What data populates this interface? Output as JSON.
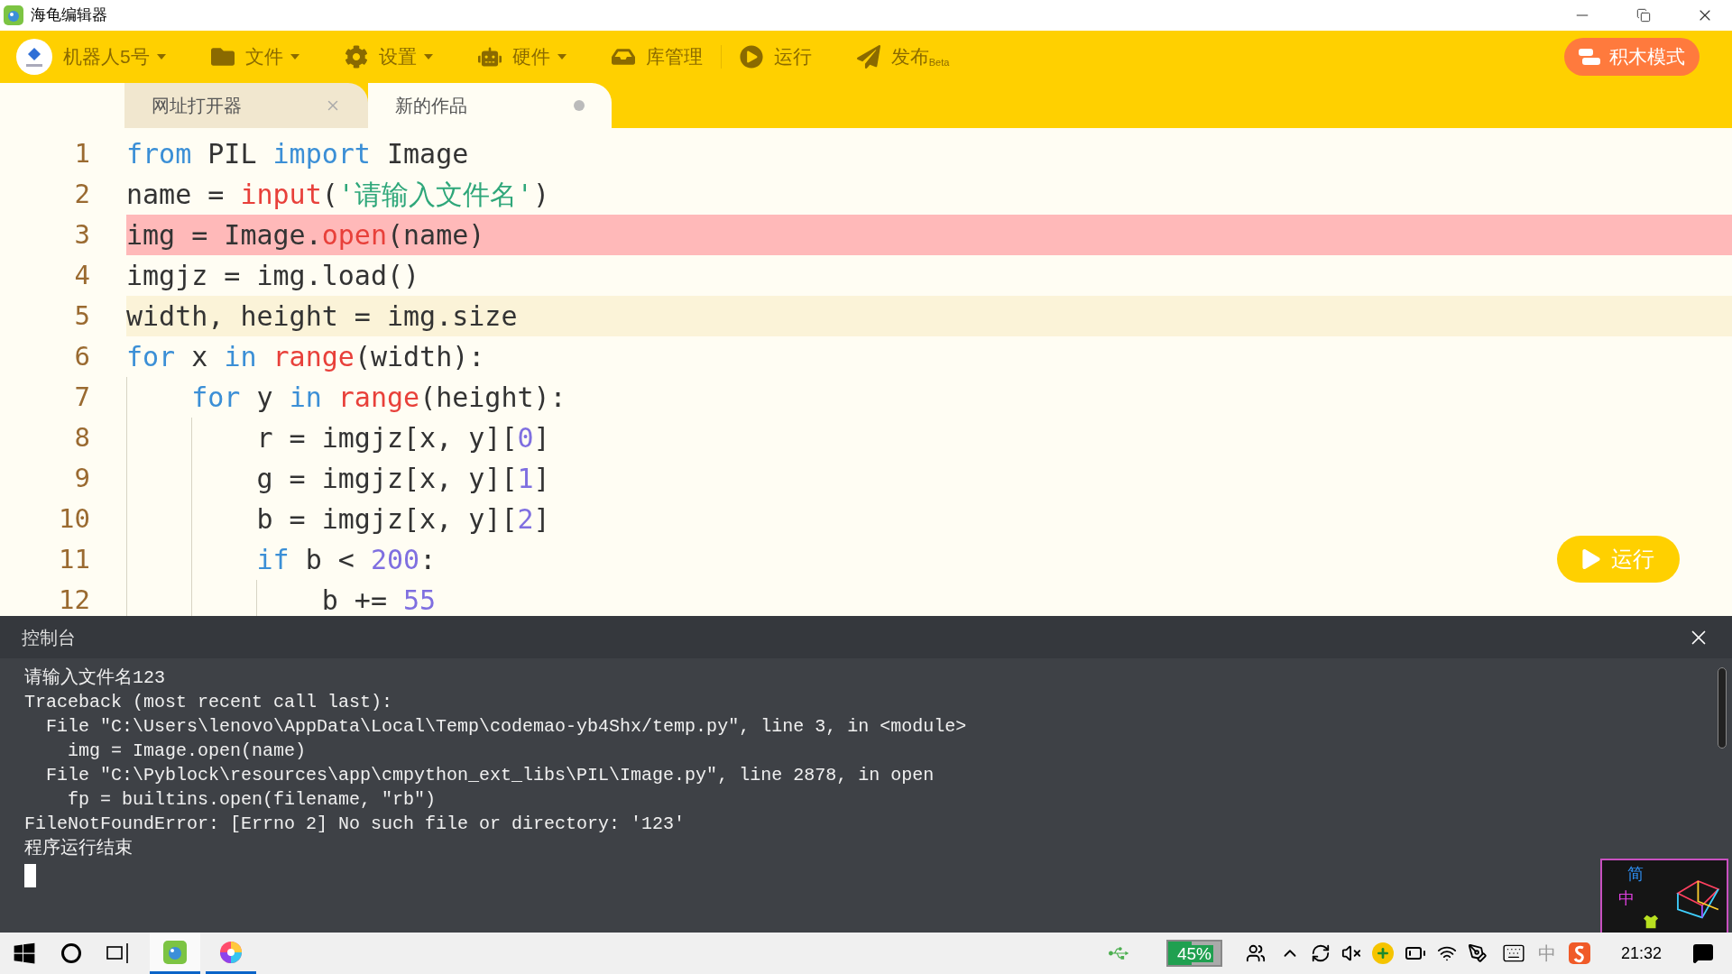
{
  "window": {
    "title": "海龟编辑器"
  },
  "toolbar": {
    "robot": {
      "label": "机器人5号"
    },
    "menus": [
      {
        "label": "文件",
        "kind": "dropdown"
      },
      {
        "label": "设置",
        "kind": "dropdown"
      },
      {
        "label": "硬件",
        "kind": "dropdown"
      },
      {
        "label": "库管理",
        "kind": "action"
      },
      {
        "label": "运行",
        "kind": "action"
      },
      {
        "label": "发布",
        "badge": "Beta",
        "kind": "action"
      }
    ],
    "mode_button": "积木模式"
  },
  "tabs": [
    {
      "label": "网址打开器",
      "selected": false,
      "modified": false
    },
    {
      "label": "新的作品",
      "selected": true,
      "modified": true
    }
  ],
  "editor": {
    "lines": [
      {
        "number": "1",
        "error": false,
        "current": false,
        "tokens": [
          {
            "text": "from",
            "kind": "keyword"
          },
          {
            "text": " PIL ",
            "kind": "plain"
          },
          {
            "text": "import",
            "kind": "keyword"
          },
          {
            "text": " Image",
            "kind": "plain"
          }
        ]
      },
      {
        "number": "2",
        "error": false,
        "current": false,
        "tokens": [
          {
            "text": "name = ",
            "kind": "plain"
          },
          {
            "text": "input",
            "kind": "func"
          },
          {
            "text": "(",
            "kind": "plain"
          },
          {
            "text": "'请输入文件名'",
            "kind": "string"
          },
          {
            "text": ")",
            "kind": "plain"
          }
        ]
      },
      {
        "number": "3",
        "error": true,
        "current": false,
        "tokens": [
          {
            "text": "img = Image.",
            "kind": "plain"
          },
          {
            "text": "open",
            "kind": "func"
          },
          {
            "text": "(name)",
            "kind": "plain"
          }
        ]
      },
      {
        "number": "4",
        "error": false,
        "current": false,
        "tokens": [
          {
            "text": "imgjz = img.load()",
            "kind": "plain"
          }
        ]
      },
      {
        "number": "5",
        "error": false,
        "current": true,
        "tokens": [
          {
            "text": "width, height = img.size",
            "kind": "plain"
          }
        ]
      },
      {
        "number": "6",
        "error": false,
        "current": false,
        "tokens": [
          {
            "text": "for",
            "kind": "keyword"
          },
          {
            "text": " x ",
            "kind": "plain"
          },
          {
            "text": "in ",
            "kind": "keyword"
          },
          {
            "text": "range",
            "kind": "func"
          },
          {
            "text": "(width):",
            "kind": "plain"
          }
        ]
      },
      {
        "number": "7",
        "error": false,
        "current": false,
        "tokens": [
          {
            "text": "    for",
            "kind": "keyword"
          },
          {
            "text": " y ",
            "kind": "plain"
          },
          {
            "text": "in ",
            "kind": "keyword"
          },
          {
            "text": "range",
            "kind": "func"
          },
          {
            "text": "(height):",
            "kind": "plain"
          }
        ]
      },
      {
        "number": "8",
        "error": false,
        "current": false,
        "tokens": [
          {
            "text": "        r = imgjz[x, y][",
            "kind": "plain"
          },
          {
            "text": "0",
            "kind": "number"
          },
          {
            "text": "]",
            "kind": "plain"
          }
        ]
      },
      {
        "number": "9",
        "error": false,
        "current": false,
        "tokens": [
          {
            "text": "        g = imgjz[x, y][",
            "kind": "plain"
          },
          {
            "text": "1",
            "kind": "number"
          },
          {
            "text": "]",
            "kind": "plain"
          }
        ]
      },
      {
        "number": "10",
        "error": false,
        "current": false,
        "tokens": [
          {
            "text": "        b = imgjz[x, y][",
            "kind": "plain"
          },
          {
            "text": "2",
            "kind": "number"
          },
          {
            "text": "]",
            "kind": "plain"
          }
        ]
      },
      {
        "number": "11",
        "error": false,
        "current": false,
        "tokens": [
          {
            "text": "        if",
            "kind": "keyword"
          },
          {
            "text": " b < ",
            "kind": "plain"
          },
          {
            "text": "200",
            "kind": "number"
          },
          {
            "text": ":",
            "kind": "plain"
          }
        ]
      },
      {
        "number": "12",
        "error": false,
        "current": false,
        "tokens": [
          {
            "text": "            b += ",
            "kind": "plain"
          },
          {
            "text": "55",
            "kind": "number"
          }
        ]
      }
    ],
    "run_button": "运行"
  },
  "console": {
    "title": "控制台",
    "lines": [
      "请输入文件名123",
      "Traceback (most recent call last):",
      "  File \"C:\\Users\\lenovo\\AppData\\Local\\Temp\\codemao-yb4Shx/temp.py\", line 3, in <module>",
      "    img = Image.open(name)",
      "  File \"C:\\Pyblock\\resources\\app\\cmpython_ext_libs\\PIL\\Image.py\", line 2878, in open",
      "    fp = builtins.open(filename, \"rb\")",
      "FileNotFoundError: [Errno 2] No such file or directory: '123'",
      "程序运行结束"
    ]
  },
  "ime_widget": {
    "labels": [
      "简",
      "中"
    ]
  },
  "taskbar": {
    "apps": [
      {
        "running": true
      },
      {
        "running": true
      }
    ],
    "battery": {
      "level": 0.45,
      "reading": "45%"
    },
    "ime": "中",
    "clock": "21:32"
  }
}
